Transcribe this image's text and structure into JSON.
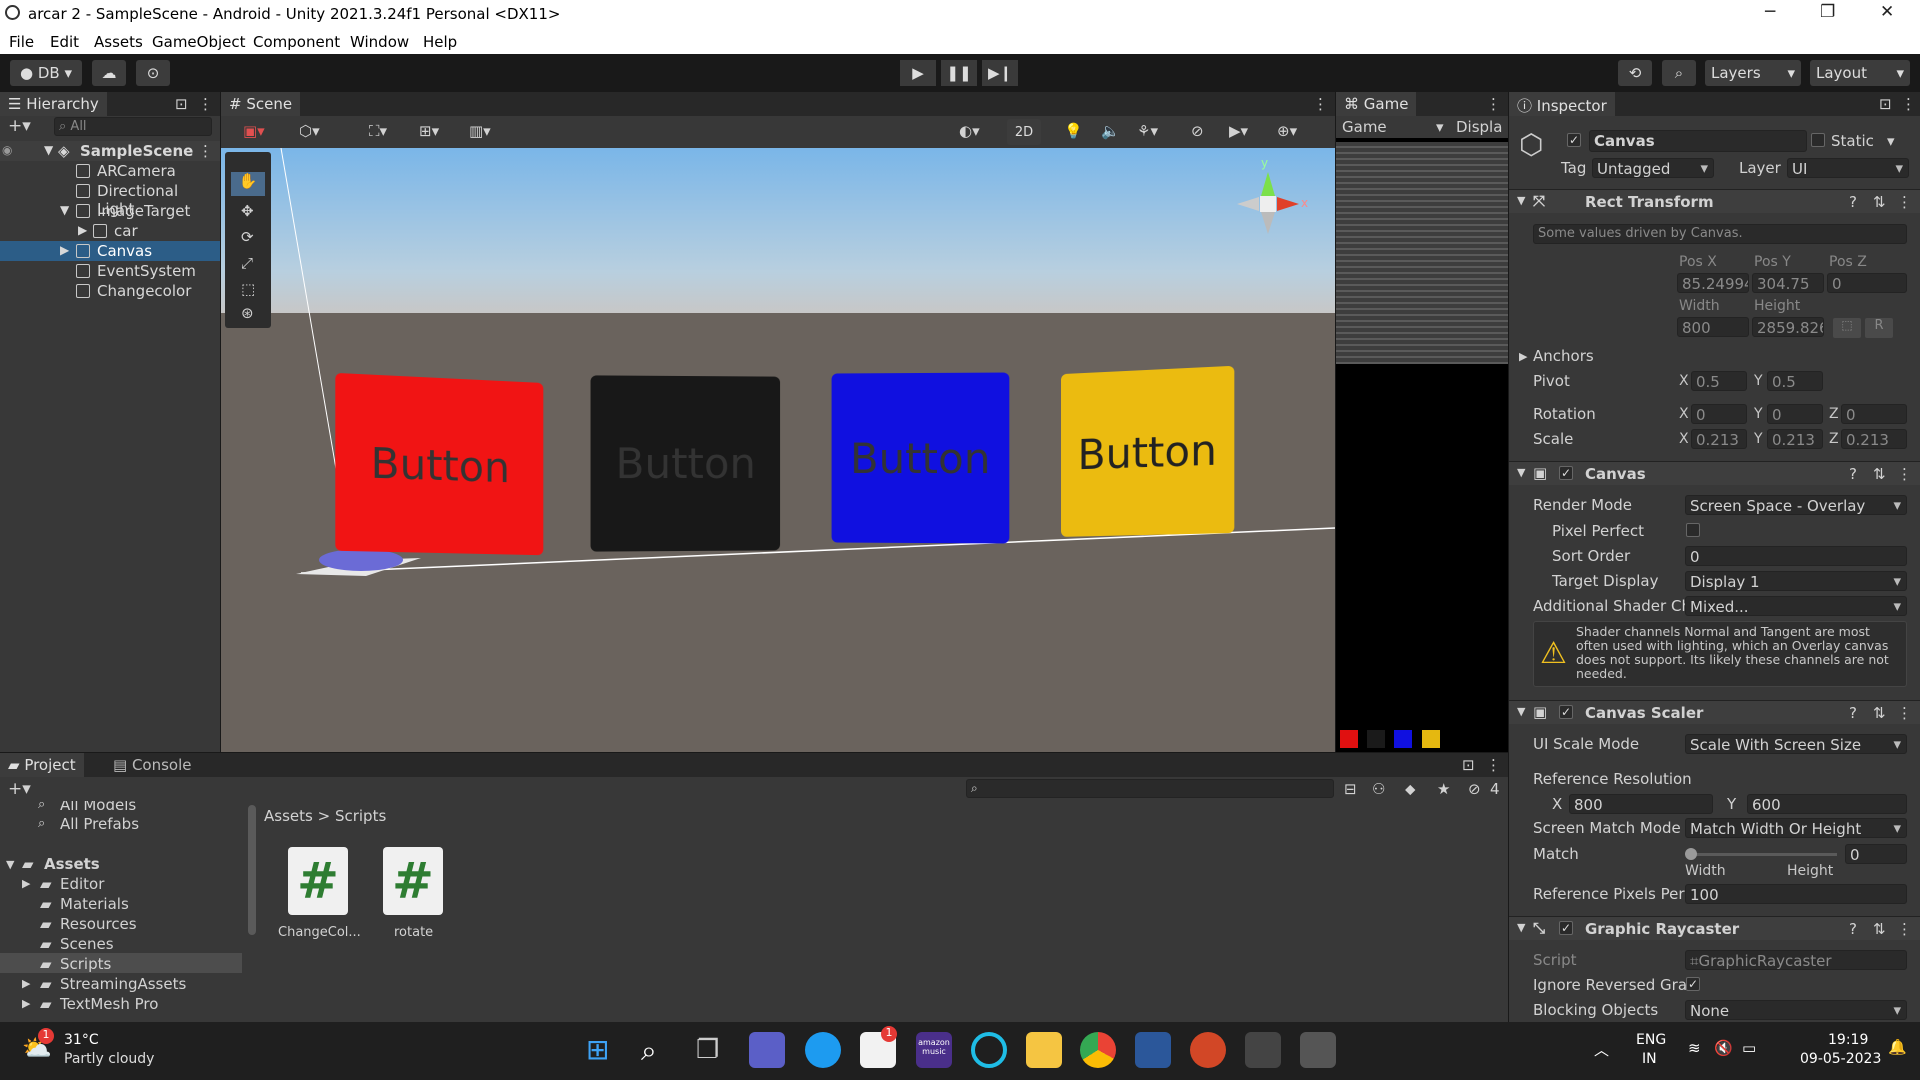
{
  "window": {
    "title": "arcar 2 - SampleScene - Android - Unity 2021.3.24f1 Personal <DX11>"
  },
  "menu": [
    "File",
    "Edit",
    "Assets",
    "GameObject",
    "Component",
    "Window",
    "Help"
  ],
  "toolbar": {
    "account": "DB",
    "layers": "Layers",
    "layout": "Layout"
  },
  "hierarchy": {
    "tab": "Hierarchy",
    "search": "All",
    "scene": "SampleScene",
    "items": [
      {
        "label": "ARCamera"
      },
      {
        "label": "Directional Light"
      },
      {
        "label": "ImageTarget"
      },
      {
        "label": "car"
      },
      {
        "label": "Canvas"
      },
      {
        "label": "EventSystem"
      },
      {
        "label": "Changecolor"
      }
    ]
  },
  "scene": {
    "tab": "Scene",
    "mode2d": "2D",
    "buttons": [
      {
        "label": "Button",
        "color": "#f11414"
      },
      {
        "label": "Button",
        "color": "#181818"
      },
      {
        "label": "Button",
        "color": "#1010e0"
      },
      {
        "label": "Button",
        "color": "#ebbb10"
      }
    ],
    "gizmo": {
      "x": "x",
      "y": "y"
    }
  },
  "game": {
    "tab": "Game",
    "dropdown": "Game",
    "display": "Displa"
  },
  "inspector": {
    "tab": "Inspector",
    "object": "Canvas",
    "static": "Static",
    "tag_label": "Tag",
    "tag": "Untagged",
    "layer_label": "Layer",
    "layer": "UI",
    "rect": {
      "title": "Rect Transform",
      "note": "Some values driven by Canvas.",
      "posx_l": "Pos X",
      "posy_l": "Pos Y",
      "posz_l": "Pos Z",
      "posx": "85.24994",
      "posy": "304.75",
      "posz": "0",
      "w_l": "Width",
      "h_l": "Height",
      "w": "800",
      "h": "2859.826",
      "r": "R",
      "anchors": "Anchors",
      "pivot": "Pivot",
      "pivx": "0.5",
      "pivy": "0.5",
      "rotation": "Rotation",
      "rx": "0",
      "ry": "0",
      "rz": "0",
      "scale": "Scale",
      "sx": "0.213",
      "sy": "0.213",
      "sz": "0.213"
    },
    "canvas": {
      "title": "Canvas",
      "render_l": "Render Mode",
      "render": "Screen Space - Overlay",
      "pixel_l": "Pixel Perfect",
      "sort_l": "Sort Order",
      "sort": "0",
      "target_l": "Target Display",
      "target": "Display 1",
      "shader_l": "Additional Shader Ch",
      "shader": "Mixed...",
      "warning": "Shader channels Normal and Tangent are most often used with lighting, which an Overlay canvas does not support. Its likely these channels are not needed."
    },
    "scaler": {
      "title": "Canvas Scaler",
      "mode_l": "UI Scale Mode",
      "mode": "Scale With Screen Size",
      "ref_l": "Reference Resolution",
      "x_l": "X",
      "x": "800",
      "y_l": "Y",
      "y": "600",
      "match_mode_l": "Screen Match Mode",
      "match_mode": "Match Width Or Height",
      "match_l": "Match",
      "match": "0",
      "width_l": "Width",
      "height_l": "Height",
      "rpp_l": "Reference Pixels Per",
      "rpp": "100"
    },
    "raycaster": {
      "title": "Graphic Raycaster",
      "script_l": "Script",
      "script": "GraphicRaycaster",
      "ignore_l": "Ignore Reversed Gra",
      "block_l": "Blocking Objects",
      "block": "None"
    }
  },
  "project": {
    "tab1": "Project",
    "tab2": "Console",
    "hidden_count": "4",
    "favs": [
      "All Models",
      "All Prefabs"
    ],
    "assets": "Assets",
    "folders": [
      "Editor",
      "Materials",
      "Resources",
      "Scenes",
      "Scripts",
      "StreamingAssets",
      "TextMesh Pro"
    ],
    "breadcrumb": [
      "Assets",
      "Scripts"
    ],
    "files": [
      "ChangeCol...",
      "rotate"
    ]
  },
  "taskbar": {
    "temp": "31°C",
    "weather": "Partly cloudy",
    "badge": "1",
    "store_badge": "1",
    "lang1": "ENG",
    "lang2": "IN",
    "time": "19:19",
    "date": "09-05-2023",
    "amazon": "amazon music"
  },
  "colors": {
    "accent": "#2c5d87",
    "panel": "#383838"
  }
}
